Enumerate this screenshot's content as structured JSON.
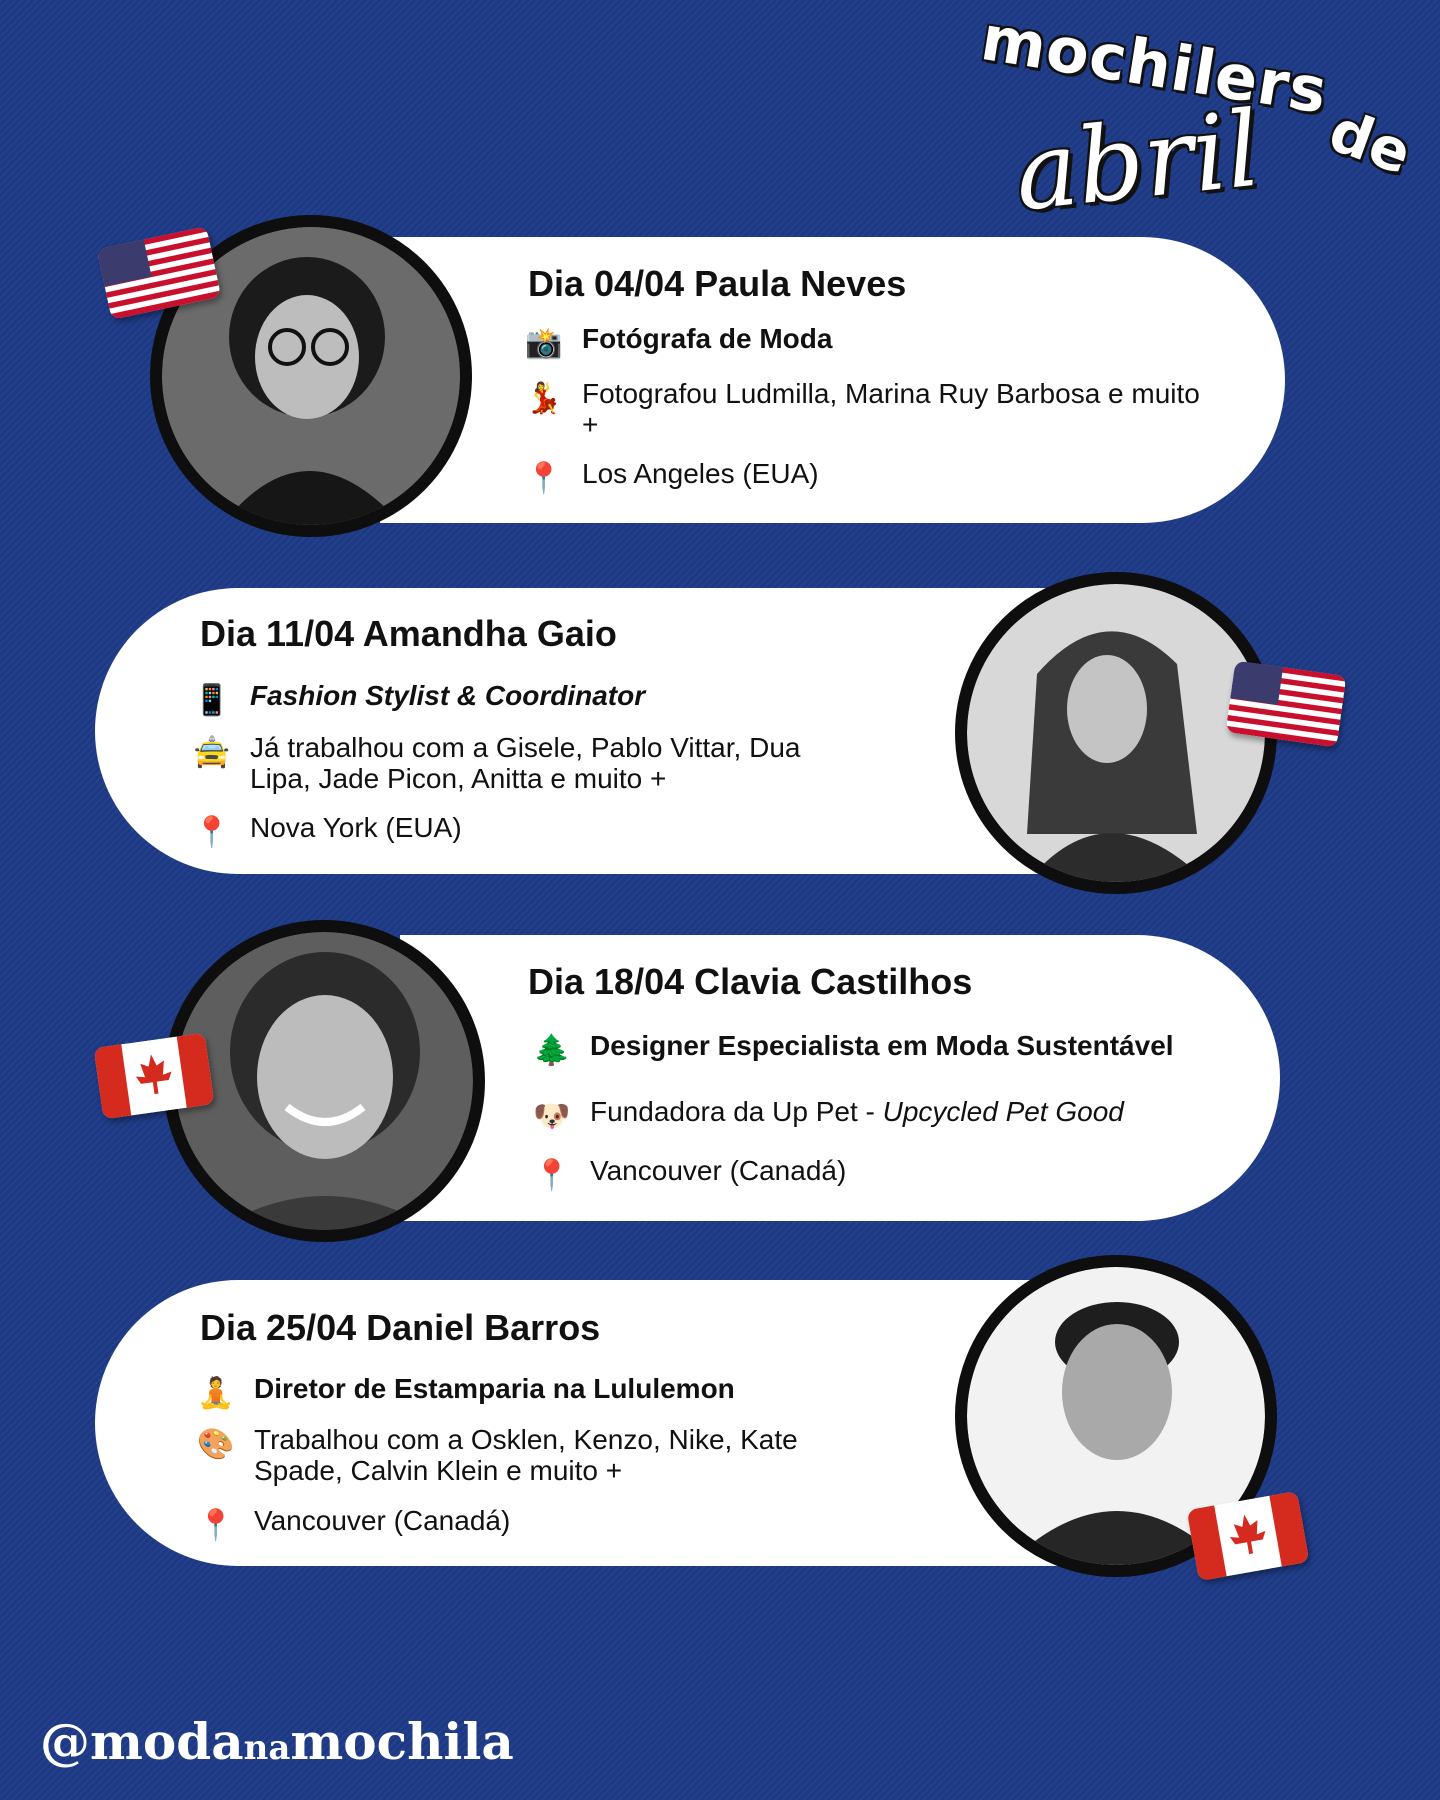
{
  "title": {
    "line1": "mochilers",
    "line2": "abril",
    "de": "de"
  },
  "people": [
    {
      "heading": "Dia 04/04 Paula Neves",
      "flag": "usa",
      "rows": [
        {
          "icon": "camera-flash-icon",
          "glyph": "📸",
          "text": "Fotógrafa de Moda"
        },
        {
          "icon": "dancer-icon",
          "glyph": "💃",
          "text": "Fotografou Ludmilla, Marina Ruy Barbosa e muito +"
        },
        {
          "icon": "pin-icon",
          "glyph": "📍",
          "text": "Los Angeles (EUA)"
        }
      ]
    },
    {
      "heading": "Dia 11/04  Amandha Gaio",
      "flag": "usa",
      "rows": [
        {
          "icon": "phone-icon",
          "glyph": "📱",
          "text": "Fashion Stylist & Coordinator"
        },
        {
          "icon": "taxi-icon",
          "glyph": "🚖",
          "text": "Já trabalhou com a Gisele, Pablo Vittar, Dua Lipa, Jade Picon, Anitta e muito +"
        },
        {
          "icon": "pin-icon",
          "glyph": "📍",
          "text": "Nova York (EUA)"
        }
      ]
    },
    {
      "heading": "Dia 18/04 Clavia Castilhos",
      "flag": "canada",
      "rows": [
        {
          "icon": "tree-icon",
          "glyph": "🌲",
          "text": "Designer Especialista em Moda Sustentável"
        },
        {
          "icon": "dog-icon",
          "glyph": "🐶",
          "text": "Fundadora da Up Pet - ",
          "text_italic": "Upcycled Pet Good"
        },
        {
          "icon": "pin-icon",
          "glyph": "📍",
          "text": "Vancouver (Canadá)"
        }
      ]
    },
    {
      "heading": "Dia 25/04  Daniel Barros",
      "flag": "canada",
      "rows": [
        {
          "icon": "meditation-icon",
          "glyph": "🧘",
          "text": "Diretor de Estamparia na Lululemon"
        },
        {
          "icon": "palette-icon",
          "glyph": "🎨",
          "text": "Trabalhou com a Osklen, Kenzo, Nike, Kate Spade, Calvin Klein e muito +"
        },
        {
          "icon": "pin-icon",
          "glyph": "📍",
          "text": "Vancouver (Canadá)"
        }
      ]
    }
  ],
  "footer": {
    "at": "@moda",
    "na": "na",
    "brand": "mochila"
  },
  "colors": {
    "background": "#1f3b87",
    "card": "#ffffff",
    "text": "#111111"
  }
}
